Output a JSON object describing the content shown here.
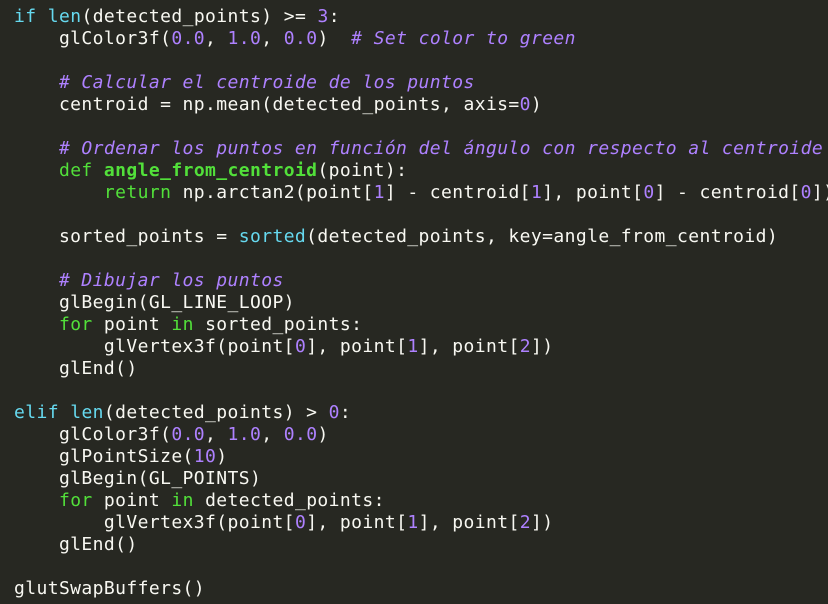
{
  "lines": [
    [
      {
        "t": "kw",
        "v": "if"
      },
      {
        "t": "text",
        "v": " "
      },
      {
        "t": "builtin",
        "v": "len"
      },
      {
        "t": "text",
        "v": "(detected_points) >= "
      },
      {
        "t": "num",
        "v": "3"
      },
      {
        "t": "text",
        "v": ":"
      }
    ],
    [
      {
        "t": "text",
        "v": "    glColor3f("
      },
      {
        "t": "num",
        "v": "0.0"
      },
      {
        "t": "text",
        "v": ", "
      },
      {
        "t": "num",
        "v": "1.0"
      },
      {
        "t": "text",
        "v": ", "
      },
      {
        "t": "num",
        "v": "0.0"
      },
      {
        "t": "text",
        "v": ")  "
      },
      {
        "t": "comment",
        "v": "# Set color to green"
      }
    ],
    [],
    [
      {
        "t": "text",
        "v": "    "
      },
      {
        "t": "comment",
        "v": "# Calcular el centroide de los puntos"
      }
    ],
    [
      {
        "t": "text",
        "v": "    centroid = np.mean(detected_points, axis="
      },
      {
        "t": "num",
        "v": "0"
      },
      {
        "t": "text",
        "v": ")"
      }
    ],
    [],
    [
      {
        "t": "text",
        "v": "    "
      },
      {
        "t": "comment",
        "v": "# Ordenar los puntos en función del ángulo con respecto al centroide"
      }
    ],
    [
      {
        "t": "text",
        "v": "    "
      },
      {
        "t": "kw2",
        "v": "def"
      },
      {
        "t": "text",
        "v": " "
      },
      {
        "t": "func",
        "v": "angle_from_centroid"
      },
      {
        "t": "text",
        "v": "(point):"
      }
    ],
    [
      {
        "t": "text",
        "v": "        "
      },
      {
        "t": "kw2",
        "v": "return"
      },
      {
        "t": "text",
        "v": " np.arctan2(point["
      },
      {
        "t": "num",
        "v": "1"
      },
      {
        "t": "text",
        "v": "] - centroid["
      },
      {
        "t": "num",
        "v": "1"
      },
      {
        "t": "text",
        "v": "], point["
      },
      {
        "t": "num",
        "v": "0"
      },
      {
        "t": "text",
        "v": "] - centroid["
      },
      {
        "t": "num",
        "v": "0"
      },
      {
        "t": "text",
        "v": "])"
      }
    ],
    [],
    [
      {
        "t": "text",
        "v": "    sorted_points = "
      },
      {
        "t": "builtin",
        "v": "sorted"
      },
      {
        "t": "text",
        "v": "(detected_points, key=angle_from_centroid)"
      }
    ],
    [],
    [
      {
        "t": "text",
        "v": "    "
      },
      {
        "t": "comment",
        "v": "# Dibujar los puntos"
      }
    ],
    [
      {
        "t": "text",
        "v": "    glBegin(GL_LINE_LOOP)"
      }
    ],
    [
      {
        "t": "text",
        "v": "    "
      },
      {
        "t": "kw2",
        "v": "for"
      },
      {
        "t": "text",
        "v": " point "
      },
      {
        "t": "kw2",
        "v": "in"
      },
      {
        "t": "text",
        "v": " sorted_points:"
      }
    ],
    [
      {
        "t": "text",
        "v": "        glVertex3f(point["
      },
      {
        "t": "num",
        "v": "0"
      },
      {
        "t": "text",
        "v": "], point["
      },
      {
        "t": "num",
        "v": "1"
      },
      {
        "t": "text",
        "v": "], point["
      },
      {
        "t": "num",
        "v": "2"
      },
      {
        "t": "text",
        "v": "])"
      }
    ],
    [
      {
        "t": "text",
        "v": "    glEnd()"
      }
    ],
    [],
    [
      {
        "t": "kw",
        "v": "elif"
      },
      {
        "t": "text",
        "v": " "
      },
      {
        "t": "builtin",
        "v": "len"
      },
      {
        "t": "text",
        "v": "(detected_points) > "
      },
      {
        "t": "num",
        "v": "0"
      },
      {
        "t": "text",
        "v": ":"
      }
    ],
    [
      {
        "t": "text",
        "v": "    glColor3f("
      },
      {
        "t": "num",
        "v": "0.0"
      },
      {
        "t": "text",
        "v": ", "
      },
      {
        "t": "num",
        "v": "1.0"
      },
      {
        "t": "text",
        "v": ", "
      },
      {
        "t": "num",
        "v": "0.0"
      },
      {
        "t": "text",
        "v": ")"
      }
    ],
    [
      {
        "t": "text",
        "v": "    glPointSize("
      },
      {
        "t": "num",
        "v": "10"
      },
      {
        "t": "text",
        "v": ")"
      }
    ],
    [
      {
        "t": "text",
        "v": "    glBegin(GL_POINTS)"
      }
    ],
    [
      {
        "t": "text",
        "v": "    "
      },
      {
        "t": "kw2",
        "v": "for"
      },
      {
        "t": "text",
        "v": " point "
      },
      {
        "t": "kw2",
        "v": "in"
      },
      {
        "t": "text",
        "v": " detected_points:"
      }
    ],
    [
      {
        "t": "text",
        "v": "        glVertex3f(point["
      },
      {
        "t": "num",
        "v": "0"
      },
      {
        "t": "text",
        "v": "], point["
      },
      {
        "t": "num",
        "v": "1"
      },
      {
        "t": "text",
        "v": "], point["
      },
      {
        "t": "num",
        "v": "2"
      },
      {
        "t": "text",
        "v": "])"
      }
    ],
    [
      {
        "t": "text",
        "v": "    glEnd()"
      }
    ],
    [],
    [
      {
        "t": "text",
        "v": "glutSwapBuffers()"
      }
    ]
  ],
  "colors": {
    "background": "#272822",
    "text": "#f8f8f2",
    "keyword": "#66d9ef",
    "keyword_green": "#52e03a",
    "number": "#ae81ff",
    "comment": "#ae81ff"
  }
}
